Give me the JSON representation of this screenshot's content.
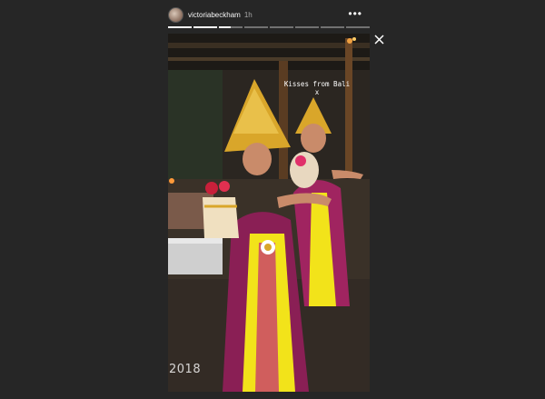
{
  "header": {
    "username": "victoriabeckham",
    "time": "1h",
    "more_label": "•••"
  },
  "progress": {
    "segments": 8,
    "active_index": 2,
    "active_fill": 0.5
  },
  "story": {
    "caption_line1": "Kisses from Bali",
    "caption_line2": "x",
    "year_text": "2018"
  },
  "colors": {
    "background": "#262626",
    "gold": "#d9a62a",
    "yellow_sash": "#f2e31a",
    "magenta": "#c2257a"
  },
  "icons": {
    "close": "close-icon",
    "more": "more-dots-icon"
  }
}
